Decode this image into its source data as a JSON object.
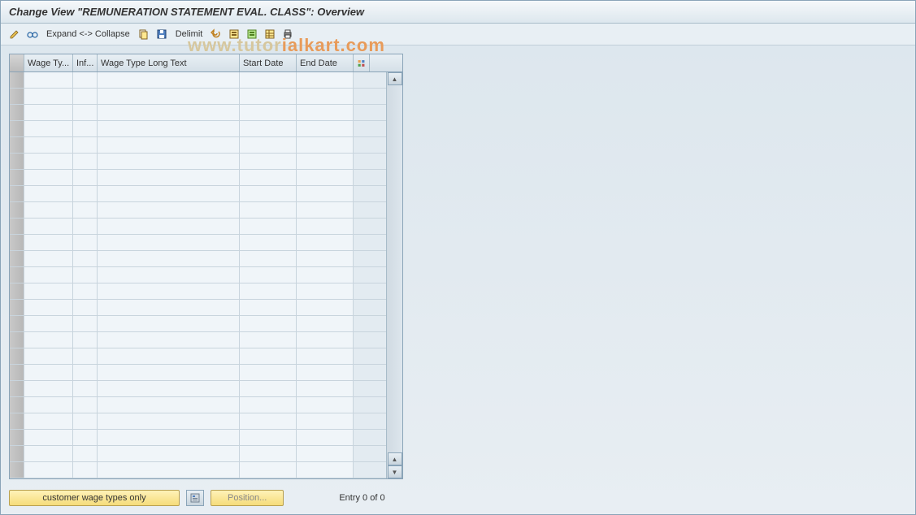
{
  "title": "Change View \"REMUNERATION STATEMENT EVAL. CLASS\": Overview",
  "toolbar": {
    "expand_label": "Expand <-> Collapse",
    "delimit_label": "Delimit"
  },
  "table": {
    "headers": {
      "wage_type": "Wage Ty...",
      "inf": "Inf...",
      "long_text": "Wage Type Long Text",
      "start_date": "Start Date",
      "end_date": "End Date"
    },
    "row_count": 25
  },
  "footer": {
    "customer_btn": "customer wage types only",
    "position_btn": "Position...",
    "entry_text": "Entry 0 of 0"
  },
  "watermark": {
    "part1": "www.tutor",
    "part2": "ialkart.com"
  },
  "icons": {
    "pencil": "pencil-icon",
    "glasses": "glasses-icon",
    "copy": "copy-icon",
    "save": "save-icon",
    "undo": "undo-icon",
    "select_all": "select-all-icon",
    "deselect": "deselect-icon",
    "print": "print-icon",
    "configure": "configure-icon",
    "position": "position-icon"
  }
}
